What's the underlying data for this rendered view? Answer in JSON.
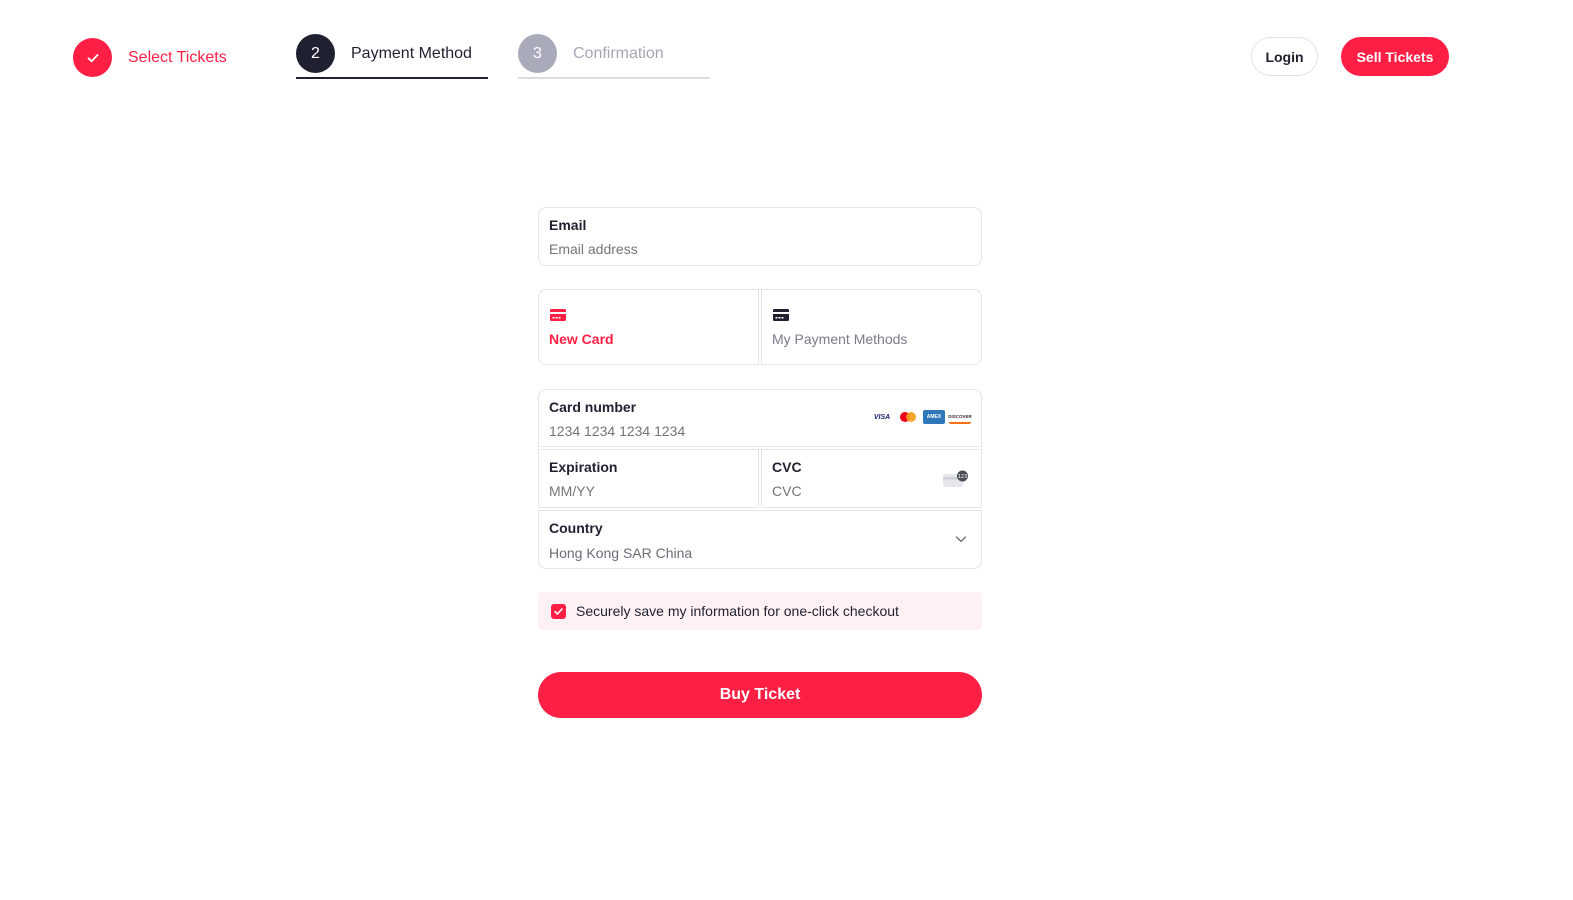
{
  "stepper": {
    "steps": [
      {
        "number": "",
        "label": "Select Tickets",
        "state": "done"
      },
      {
        "number": "2",
        "label": "Payment Method",
        "state": "active"
      },
      {
        "number": "3",
        "label": "Confirmation",
        "state": "upcoming"
      }
    ]
  },
  "header": {
    "login_label": "Login",
    "sell_label": "Sell Tickets"
  },
  "form": {
    "email": {
      "label": "Email",
      "placeholder": "Email address"
    },
    "payment_tabs": [
      {
        "label": "New Card",
        "selected": true
      },
      {
        "label": "My Payment Methods",
        "selected": false
      }
    ],
    "card_number": {
      "label": "Card number",
      "placeholder": "1234 1234 1234 1234"
    },
    "brands": {
      "visa": "VISA",
      "amex": "AMEX",
      "discover": "DISCOVER"
    },
    "expiration": {
      "label": "Expiration",
      "placeholder": "MM/YY"
    },
    "cvc": {
      "label": "CVC",
      "placeholder": "CVC"
    },
    "country": {
      "label": "Country",
      "value": "Hong Kong SAR China"
    },
    "save_info": {
      "label": "Securely save my information for one-click checkout",
      "checked": true
    },
    "buy_label": "Buy Ticket"
  },
  "colors": {
    "accent": "#ff1f45",
    "dark": "#1f2130",
    "muted": "#a9abba"
  }
}
